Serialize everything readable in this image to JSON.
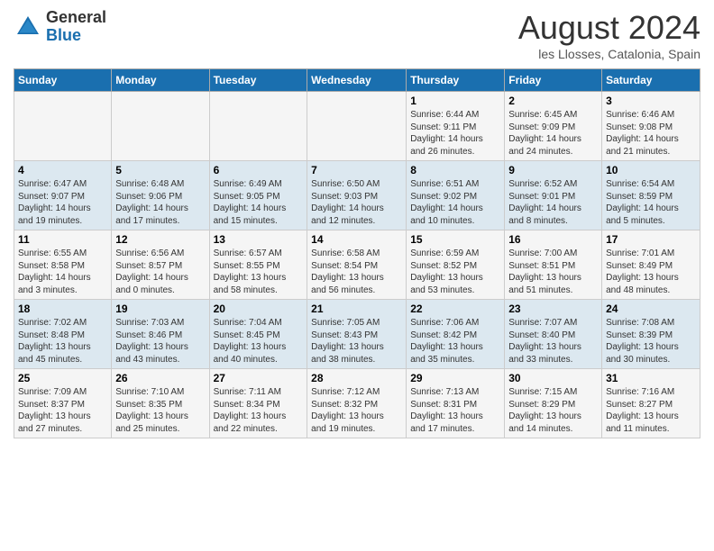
{
  "header": {
    "logo_general": "General",
    "logo_blue": "Blue",
    "month_title": "August 2024",
    "location": "les Llosses, Catalonia, Spain"
  },
  "weekdays": [
    "Sunday",
    "Monday",
    "Tuesday",
    "Wednesday",
    "Thursday",
    "Friday",
    "Saturday"
  ],
  "weeks": [
    [
      {
        "day": "",
        "info": ""
      },
      {
        "day": "",
        "info": ""
      },
      {
        "day": "",
        "info": ""
      },
      {
        "day": "",
        "info": ""
      },
      {
        "day": "1",
        "info": "Sunrise: 6:44 AM\nSunset: 9:11 PM\nDaylight: 14 hours\nand 26 minutes."
      },
      {
        "day": "2",
        "info": "Sunrise: 6:45 AM\nSunset: 9:09 PM\nDaylight: 14 hours\nand 24 minutes."
      },
      {
        "day": "3",
        "info": "Sunrise: 6:46 AM\nSunset: 9:08 PM\nDaylight: 14 hours\nand 21 minutes."
      }
    ],
    [
      {
        "day": "4",
        "info": "Sunrise: 6:47 AM\nSunset: 9:07 PM\nDaylight: 14 hours\nand 19 minutes."
      },
      {
        "day": "5",
        "info": "Sunrise: 6:48 AM\nSunset: 9:06 PM\nDaylight: 14 hours\nand 17 minutes."
      },
      {
        "day": "6",
        "info": "Sunrise: 6:49 AM\nSunset: 9:05 PM\nDaylight: 14 hours\nand 15 minutes."
      },
      {
        "day": "7",
        "info": "Sunrise: 6:50 AM\nSunset: 9:03 PM\nDaylight: 14 hours\nand 12 minutes."
      },
      {
        "day": "8",
        "info": "Sunrise: 6:51 AM\nSunset: 9:02 PM\nDaylight: 14 hours\nand 10 minutes."
      },
      {
        "day": "9",
        "info": "Sunrise: 6:52 AM\nSunset: 9:01 PM\nDaylight: 14 hours\nand 8 minutes."
      },
      {
        "day": "10",
        "info": "Sunrise: 6:54 AM\nSunset: 8:59 PM\nDaylight: 14 hours\nand 5 minutes."
      }
    ],
    [
      {
        "day": "11",
        "info": "Sunrise: 6:55 AM\nSunset: 8:58 PM\nDaylight: 14 hours\nand 3 minutes."
      },
      {
        "day": "12",
        "info": "Sunrise: 6:56 AM\nSunset: 8:57 PM\nDaylight: 14 hours\nand 0 minutes."
      },
      {
        "day": "13",
        "info": "Sunrise: 6:57 AM\nSunset: 8:55 PM\nDaylight: 13 hours\nand 58 minutes."
      },
      {
        "day": "14",
        "info": "Sunrise: 6:58 AM\nSunset: 8:54 PM\nDaylight: 13 hours\nand 56 minutes."
      },
      {
        "day": "15",
        "info": "Sunrise: 6:59 AM\nSunset: 8:52 PM\nDaylight: 13 hours\nand 53 minutes."
      },
      {
        "day": "16",
        "info": "Sunrise: 7:00 AM\nSunset: 8:51 PM\nDaylight: 13 hours\nand 51 minutes."
      },
      {
        "day": "17",
        "info": "Sunrise: 7:01 AM\nSunset: 8:49 PM\nDaylight: 13 hours\nand 48 minutes."
      }
    ],
    [
      {
        "day": "18",
        "info": "Sunrise: 7:02 AM\nSunset: 8:48 PM\nDaylight: 13 hours\nand 45 minutes."
      },
      {
        "day": "19",
        "info": "Sunrise: 7:03 AM\nSunset: 8:46 PM\nDaylight: 13 hours\nand 43 minutes."
      },
      {
        "day": "20",
        "info": "Sunrise: 7:04 AM\nSunset: 8:45 PM\nDaylight: 13 hours\nand 40 minutes."
      },
      {
        "day": "21",
        "info": "Sunrise: 7:05 AM\nSunset: 8:43 PM\nDaylight: 13 hours\nand 38 minutes."
      },
      {
        "day": "22",
        "info": "Sunrise: 7:06 AM\nSunset: 8:42 PM\nDaylight: 13 hours\nand 35 minutes."
      },
      {
        "day": "23",
        "info": "Sunrise: 7:07 AM\nSunset: 8:40 PM\nDaylight: 13 hours\nand 33 minutes."
      },
      {
        "day": "24",
        "info": "Sunrise: 7:08 AM\nSunset: 8:39 PM\nDaylight: 13 hours\nand 30 minutes."
      }
    ],
    [
      {
        "day": "25",
        "info": "Sunrise: 7:09 AM\nSunset: 8:37 PM\nDaylight: 13 hours\nand 27 minutes."
      },
      {
        "day": "26",
        "info": "Sunrise: 7:10 AM\nSunset: 8:35 PM\nDaylight: 13 hours\nand 25 minutes."
      },
      {
        "day": "27",
        "info": "Sunrise: 7:11 AM\nSunset: 8:34 PM\nDaylight: 13 hours\nand 22 minutes."
      },
      {
        "day": "28",
        "info": "Sunrise: 7:12 AM\nSunset: 8:32 PM\nDaylight: 13 hours\nand 19 minutes."
      },
      {
        "day": "29",
        "info": "Sunrise: 7:13 AM\nSunset: 8:31 PM\nDaylight: 13 hours\nand 17 minutes."
      },
      {
        "day": "30",
        "info": "Sunrise: 7:15 AM\nSunset: 8:29 PM\nDaylight: 13 hours\nand 14 minutes."
      },
      {
        "day": "31",
        "info": "Sunrise: 7:16 AM\nSunset: 8:27 PM\nDaylight: 13 hours\nand 11 minutes."
      }
    ]
  ]
}
